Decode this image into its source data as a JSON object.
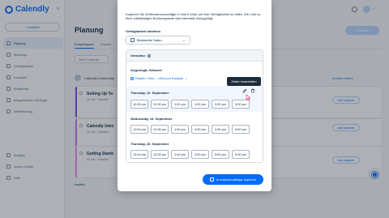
{
  "app": {
    "name": "Calendly"
  },
  "sidebar": {
    "create_label": "+ Erstellen",
    "items": [
      {
        "label": "Planung",
        "active": true,
        "icon": "link-icon"
      },
      {
        "label": "Meetings",
        "active": false,
        "icon": "calendar-icon"
      },
      {
        "label": "Verfügbarkeit",
        "active": false,
        "icon": "clock-icon"
      },
      {
        "label": "Kontakte",
        "active": false,
        "icon": "contacts-icon"
      },
      {
        "label": "Workflows",
        "active": false,
        "icon": "workflow-icon"
      },
      {
        "label": "Integrationen und Apps",
        "active": false,
        "icon": "apps-icon"
      },
      {
        "label": "Weiterleitung",
        "active": false,
        "icon": "routing-icon"
      }
    ],
    "bottom_items": [
      {
        "label": "Analytik",
        "icon": "analytics-icon"
      },
      {
        "label": "Admin-Center",
        "icon": "admin-icon"
      },
      {
        "label": "Hilfe",
        "icon": "help-icon"
      }
    ]
  },
  "main": {
    "title": "Planung",
    "tabs": [
      "Ereignistypen",
      "Einmal"
    ],
    "filter_label": "Mein Calendly",
    "community_label": "Calendly Community",
    "cards": [
      {
        "title": "Setting Up Yo",
        "sub": "30 min · Einzelter",
        "stripe": "#8247f5"
      },
      {
        "title": "Calendly Intro",
        "sub": "30 min · Einzelter",
        "stripe": "#d36cff"
      },
      {
        "title": "Getting Starte",
        "sub": "30 min · Einzelter",
        "stripe": "#f18cff"
      }
    ],
    "scheduling_label": "Inaktiv",
    "create_button": "+ Erstellen",
    "new_contact": "Kontakt erstellen",
    "copy_link_label": "Link kopieren"
  },
  "modal": {
    "intro": "Kopieren Sie Zeitfenstervorschläge in eine E-Mail, um Ihre Verfügbarkeit zu teilen. Der Link zu Ihrer vollständigen Buchungsseite wird ebenfalls hinzugefügt.",
    "availability_label": "Verfügbarkeit anbieten",
    "availability_select": "Bestimmte Daten",
    "preview": {
      "title": "Vorschau",
      "timezone_label": "Angezeigte Zeitzone",
      "timezone_value": "Eastern Time – USA und Kanada",
      "tooltip": "Zeiten bearbeiten",
      "days": [
        {
          "title": "Thursday, 19. September",
          "slots": [
            "12:00 pm",
            "12:30 pm",
            "1:00 pm",
            "3:00 pm",
            "3:30 pm",
            "5:00 pm"
          ]
        },
        {
          "title": "Wednesday, 24. September",
          "slots": [
            "12:00 pm",
            "12:30 pm",
            "1:00 pm",
            "4:00 pm",
            "4:30 pm",
            "5:00 pm"
          ]
        },
        {
          "title": "Thursday, 25. September",
          "slots": [
            "12:00 pm",
            "12:30 pm",
            "1:00 pm",
            "3:00 pm",
            "5:00 pm",
            "5:30 pm"
          ]
        }
      ]
    },
    "copy_button": "In zwischenablage kopieren"
  },
  "colors": {
    "accent": "#006bff",
    "tooltip_bg": "#1d2c3c"
  }
}
